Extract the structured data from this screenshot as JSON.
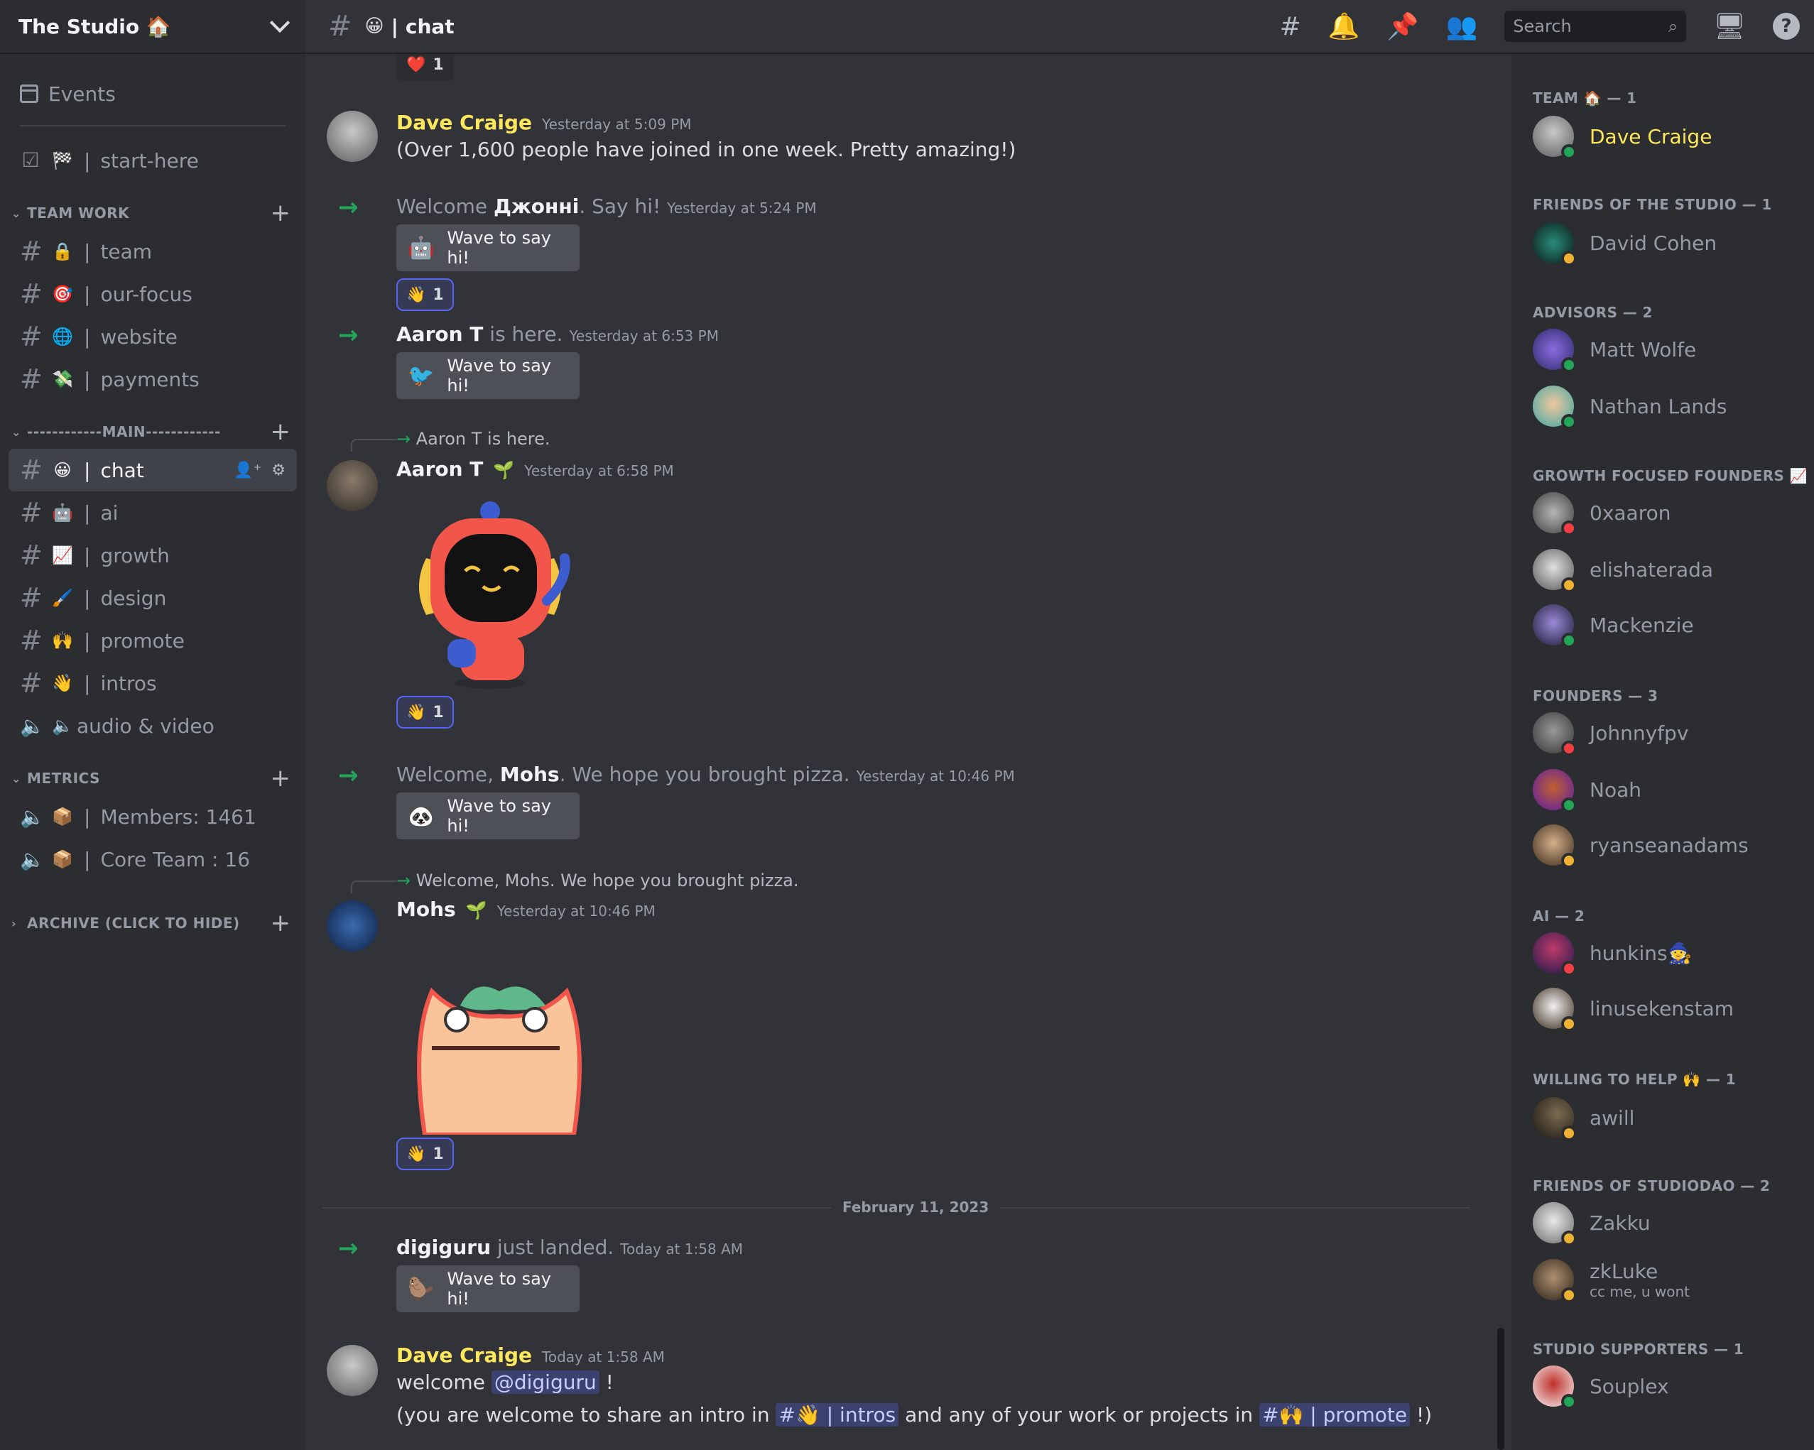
{
  "server": {
    "name": "The Studio 🏠"
  },
  "sidebar": {
    "events_label": "Events",
    "start_here": {
      "emoji": "🏁",
      "label": "start-here"
    },
    "categories": [
      {
        "name": "TEAM WORK",
        "channels": [
          {
            "emoji": "🔒",
            "label": "team"
          },
          {
            "emoji": "🎯",
            "label": "our-focus"
          },
          {
            "emoji": "🌐",
            "label": "website"
          },
          {
            "emoji": "💸",
            "label": "payments"
          }
        ]
      },
      {
        "name": "------------MAIN------------",
        "channels": [
          {
            "emoji": "😀",
            "label": "chat"
          },
          {
            "emoji": "🤖",
            "label": "ai"
          },
          {
            "emoji": "📈",
            "label": "growth"
          },
          {
            "emoji": "🖌️",
            "label": "design"
          },
          {
            "emoji": "🙌",
            "label": "promote"
          },
          {
            "emoji": "👋",
            "label": "intros"
          },
          {
            "emoji": "🔈",
            "label": "audio & video"
          }
        ]
      },
      {
        "name": "METRICS",
        "channels": [
          {
            "emoji": "📦",
            "label": "Members: 1461"
          },
          {
            "emoji": "📦",
            "label": "Core Team : 16"
          }
        ]
      },
      {
        "name": "ARCHIVE (CLICK TO HIDE)"
      }
    ]
  },
  "header": {
    "channel_emoji": "😀",
    "channel_name": "chat",
    "search_placeholder": "Search"
  },
  "messages": {
    "top_reaction": {
      "emoji": "❤️",
      "count": "1"
    },
    "m1": {
      "author": "Dave Craige",
      "time": "Yesterday at 5:09 PM",
      "text": "(Over 1,600 people have joined in one week.  Pretty amazing!)"
    },
    "j1": {
      "pre": "Welcome ",
      "name": "Джонні",
      "post": ". Say hi!",
      "time": "Yesterday at 5:24 PM",
      "button": "Wave to say hi!",
      "sticker": "🤖",
      "reaction": {
        "emoji": "👋",
        "count": "1"
      }
    },
    "j2": {
      "name": "Aaron T",
      "post": " is here.",
      "time": "Yesterday at 6:53 PM",
      "button": "Wave to say hi!",
      "sticker": "🐦"
    },
    "m2": {
      "reply": "Aaron T is here.",
      "author": "Aaron T",
      "badge": "🌱",
      "time": "Yesterday at 6:58 PM",
      "reaction": {
        "emoji": "👋",
        "count": "1"
      }
    },
    "j3": {
      "pre": "Welcome, ",
      "name": "Mohs",
      "post": ". We hope you brought pizza.",
      "time": "Yesterday at 10:46 PM",
      "button": "Wave to say hi!",
      "sticker": "🐼"
    },
    "m3": {
      "reply": "Welcome, Mohs. We hope you brought pizza.",
      "author": "Mohs",
      "badge": "🌱",
      "time": "Yesterday at 10:46 PM",
      "reaction": {
        "emoji": "👋",
        "count": "1"
      }
    },
    "date_divider": "February 11, 2023",
    "j4": {
      "name": "digiguru",
      "post": " just landed.",
      "time": "Today at 1:58 AM",
      "button": "Wave to say hi!",
      "sticker": "🦫"
    },
    "m4": {
      "author": "Dave Craige",
      "time": "Today at 1:58 AM",
      "line1_pre": "welcome ",
      "mention": "@digiguru",
      "line1_post": " !",
      "line2_pre": "(you are welcome to share an intro in ",
      "ch1": "#👋 | intros",
      "line2_mid": " and any of your work or projects in ",
      "ch2": "#🙌 | promote",
      "line2_post": " !)"
    }
  },
  "members": {
    "sections": [
      {
        "title": "TEAM 🏠 — 1",
        "people": [
          {
            "name": "Dave Craige",
            "status": "online"
          }
        ]
      },
      {
        "title": "FRIENDS OF THE STUDIO — 1",
        "people": [
          {
            "name": "David Cohen",
            "status": "idle"
          }
        ]
      },
      {
        "title": "ADVISORS — 2",
        "people": [
          {
            "name": "Matt Wolfe",
            "status": "online"
          },
          {
            "name": "Nathan Lands",
            "status": "online"
          }
        ]
      },
      {
        "title": "GROWTH FOCUSED FOUNDERS 📈 ...",
        "people": [
          {
            "name": "0xaaron",
            "status": "dnd"
          },
          {
            "name": "elishaterada",
            "status": "idle"
          },
          {
            "name": "Mackenzie",
            "status": "online"
          }
        ]
      },
      {
        "title": "FOUNDERS — 3",
        "people": [
          {
            "name": "Johnnyfpv",
            "status": "dnd"
          },
          {
            "name": "Noah",
            "status": "online"
          },
          {
            "name": "ryanseanadams",
            "status": "idle"
          }
        ]
      },
      {
        "title": "AI — 2",
        "people": [
          {
            "name": "hunkins🧙",
            "status": "dnd"
          },
          {
            "name": "linusekenstam",
            "status": "idle"
          }
        ]
      },
      {
        "title": "WILLING TO HELP 🙌 — 1",
        "people": [
          {
            "name": "awill",
            "status": "idle"
          }
        ]
      },
      {
        "title": "FRIENDS OF STUDIODAO — 2",
        "people": [
          {
            "name": "Zakku",
            "status": "idle"
          },
          {
            "name": "zkLuke",
            "sub": "cc me, u wont",
            "status": "idle"
          }
        ]
      },
      {
        "title": "STUDIO SUPPORTERS — 1",
        "people": [
          {
            "name": "Souplex",
            "status": "online"
          }
        ]
      }
    ]
  },
  "colors": {
    "online": "#23a55a",
    "idle": "#f0b232",
    "dnd": "#f23f43",
    "accent": "#5865f2",
    "owner": "#fee75c"
  }
}
